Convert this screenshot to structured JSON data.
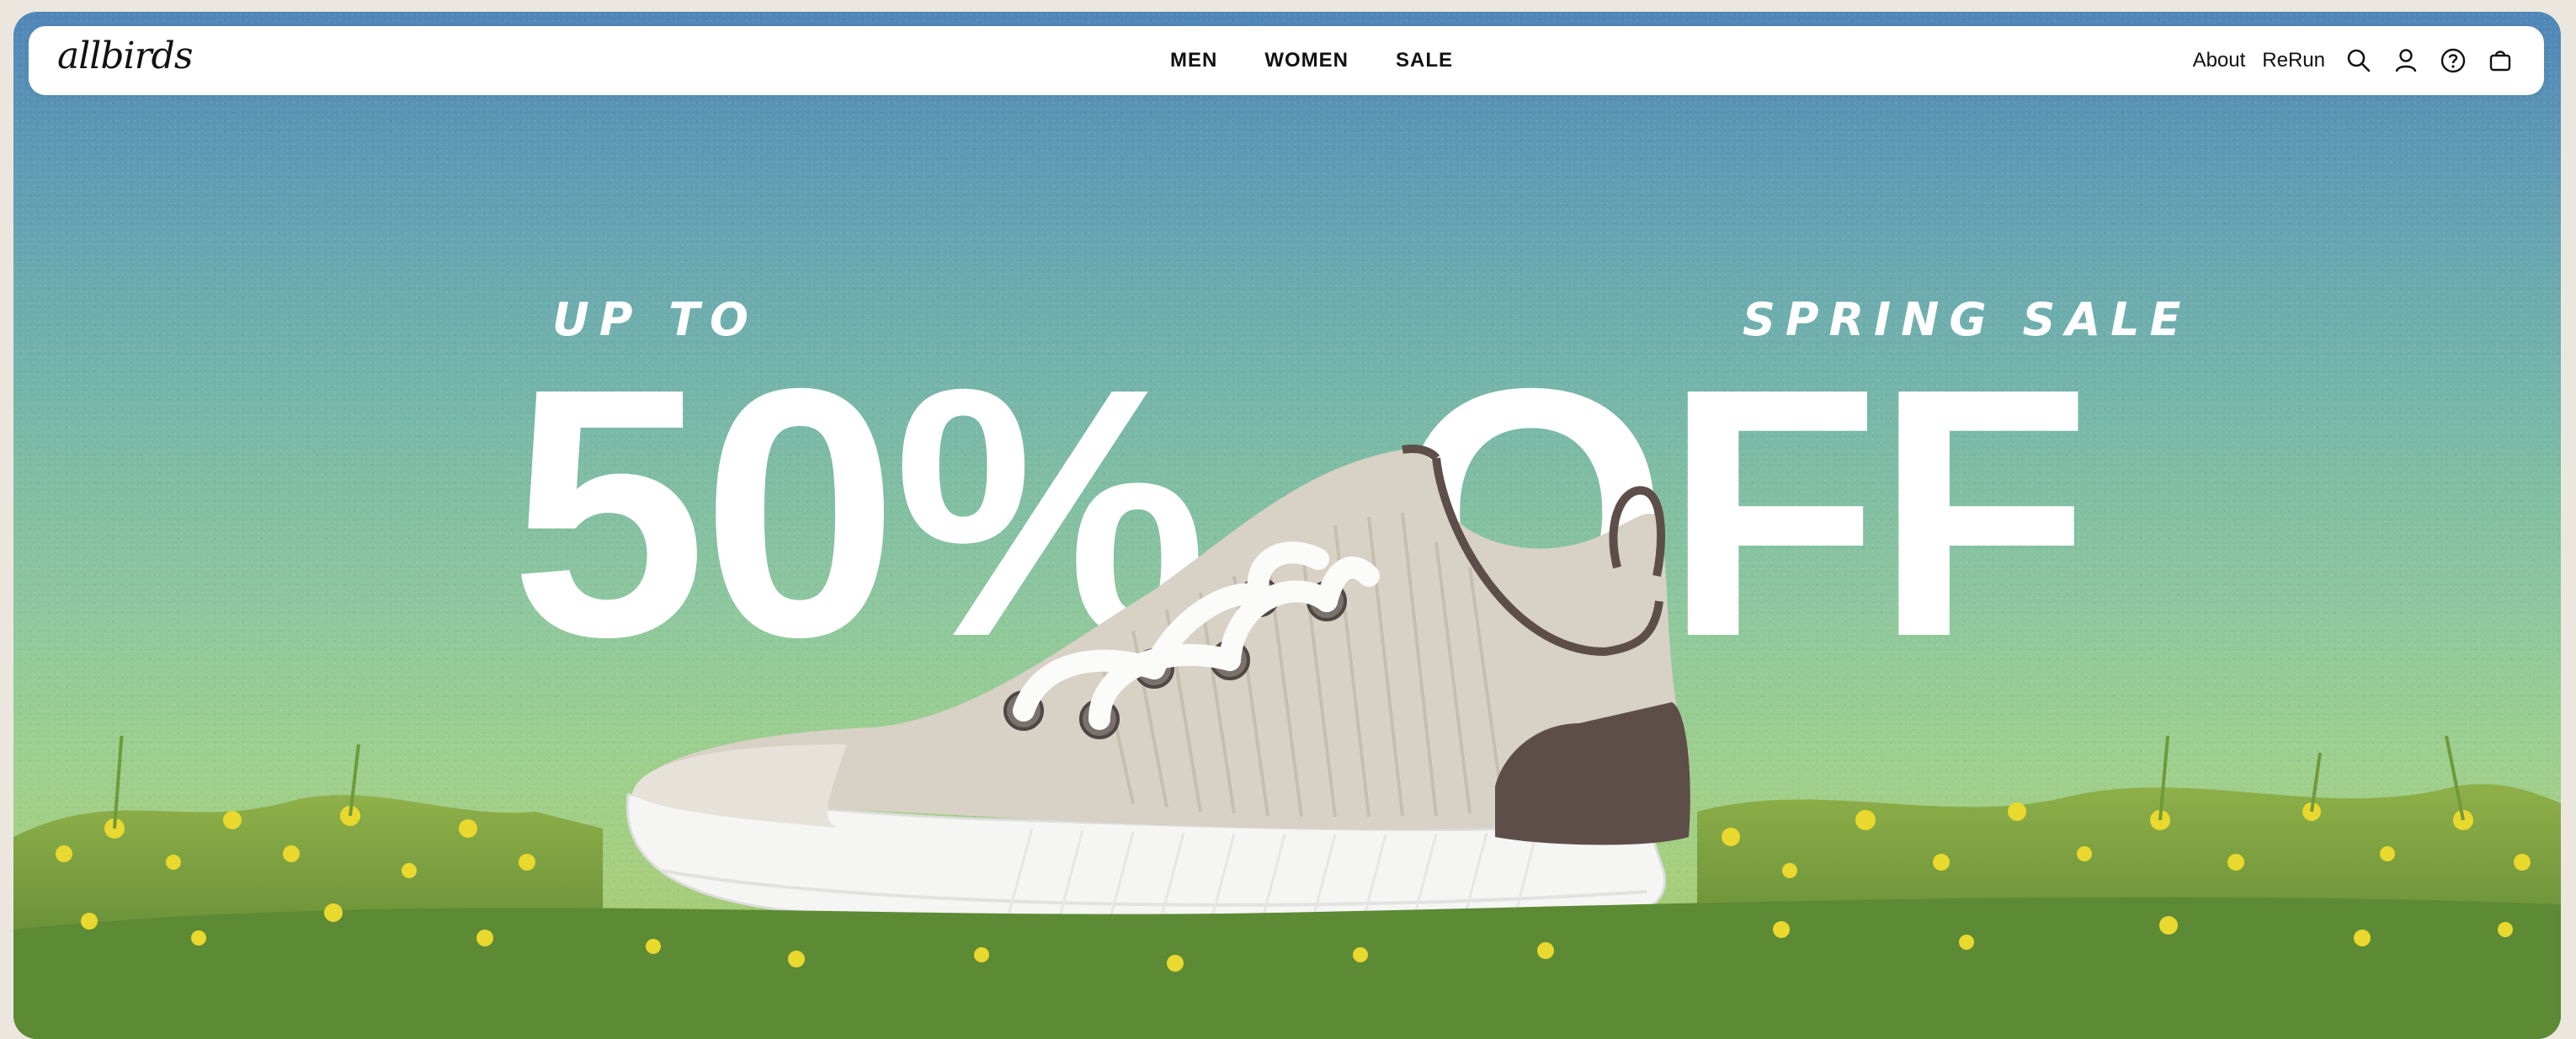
{
  "brand": {
    "logo_text": "allbirds"
  },
  "nav": {
    "primary": [
      {
        "label": "MEN"
      },
      {
        "label": "WOMEN"
      },
      {
        "label": "SALE"
      }
    ],
    "secondary": [
      {
        "label": "About"
      },
      {
        "label": "ReRun"
      }
    ],
    "icons": [
      "search-icon",
      "account-icon",
      "help-icon",
      "cart-icon"
    ]
  },
  "hero": {
    "kicker_left": "UP TO",
    "kicker_right": "SPRING SALE",
    "headline_left": "50%",
    "headline_right": "OFF",
    "image": "sneaker-in-grass"
  },
  "colors": {
    "sky_top": "#4f86b8",
    "sky_bottom": "#9ccf8f",
    "headline": "#ffffff",
    "nav_bg": "#ffffff",
    "shoe_upper": "#d9d2c6",
    "shoe_heel": "#5e4e4a",
    "shoe_sole": "#f4f4f2"
  }
}
